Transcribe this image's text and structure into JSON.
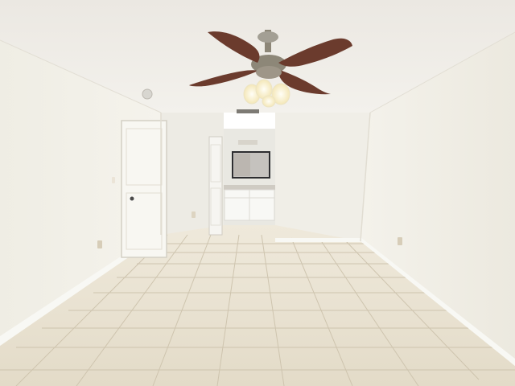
{
  "image": {
    "kind": "photograph",
    "subject": "empty room"
  },
  "palette": {
    "ceiling": "#efede9",
    "left_wall": "#f1efe8",
    "right_wall": "#f0eee6",
    "back_wall": "#eeece5",
    "floor_tile": "#e8e2d3",
    "grout": "#cfc6b2",
    "fan_blade": "#6b3b2d",
    "fan_metal": "#8d8778",
    "light_glass": "#fff8df",
    "door": "#f7f6f2",
    "vanity": "#f7f7f4",
    "counter": "#cfcbc3",
    "mirror_frame": "#2d2d30",
    "mirror_glass": "#c3c1bd",
    "baseboard": "#f7f7f3",
    "outlet": "#d7cdb8"
  }
}
